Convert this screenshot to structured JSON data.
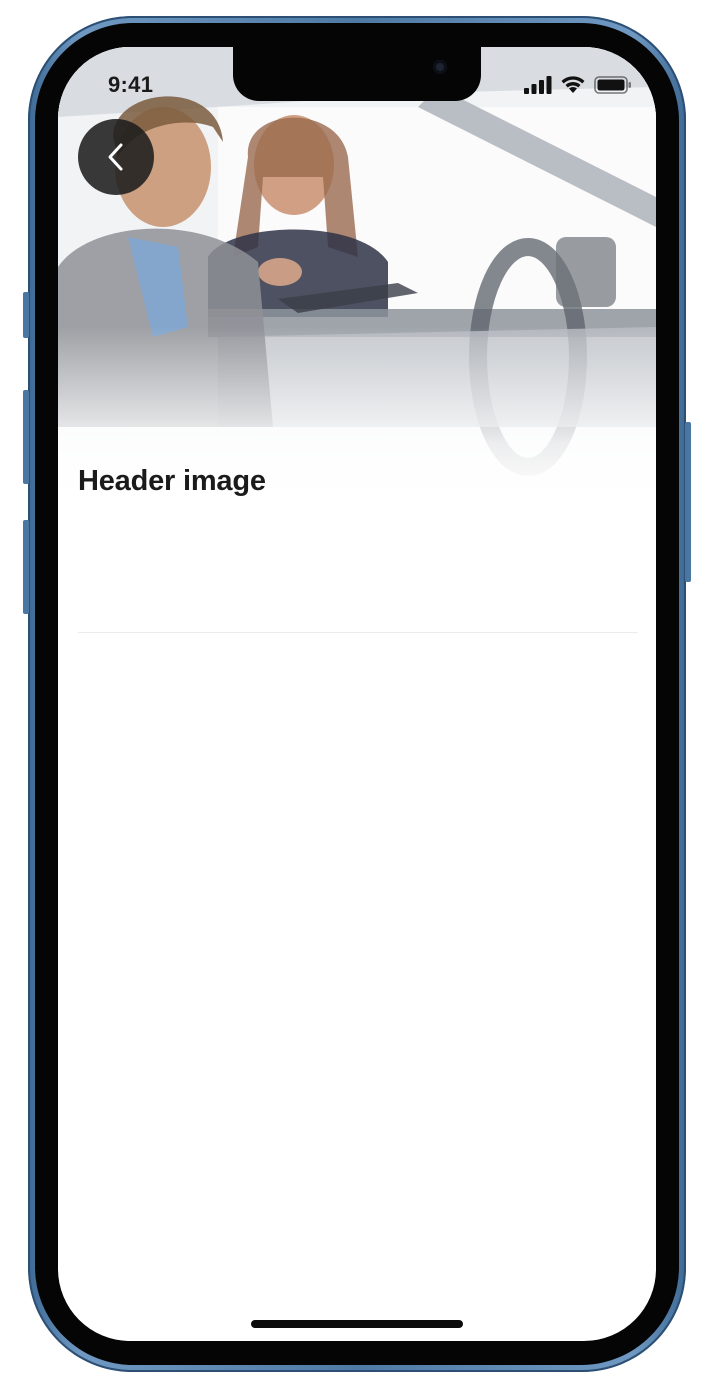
{
  "status_bar": {
    "time": "9:41",
    "icons": [
      "cellular-signal-icon",
      "wifi-icon",
      "battery-icon"
    ]
  },
  "header": {
    "back_icon": "chevron-left-icon",
    "image_description_icon": "header-photo"
  },
  "content": {
    "title": "Header image"
  },
  "colors": {
    "phone_frame": "#4f7aa6",
    "back_button_bg": "#1e1e1e",
    "title_text": "#1b1b1b"
  }
}
